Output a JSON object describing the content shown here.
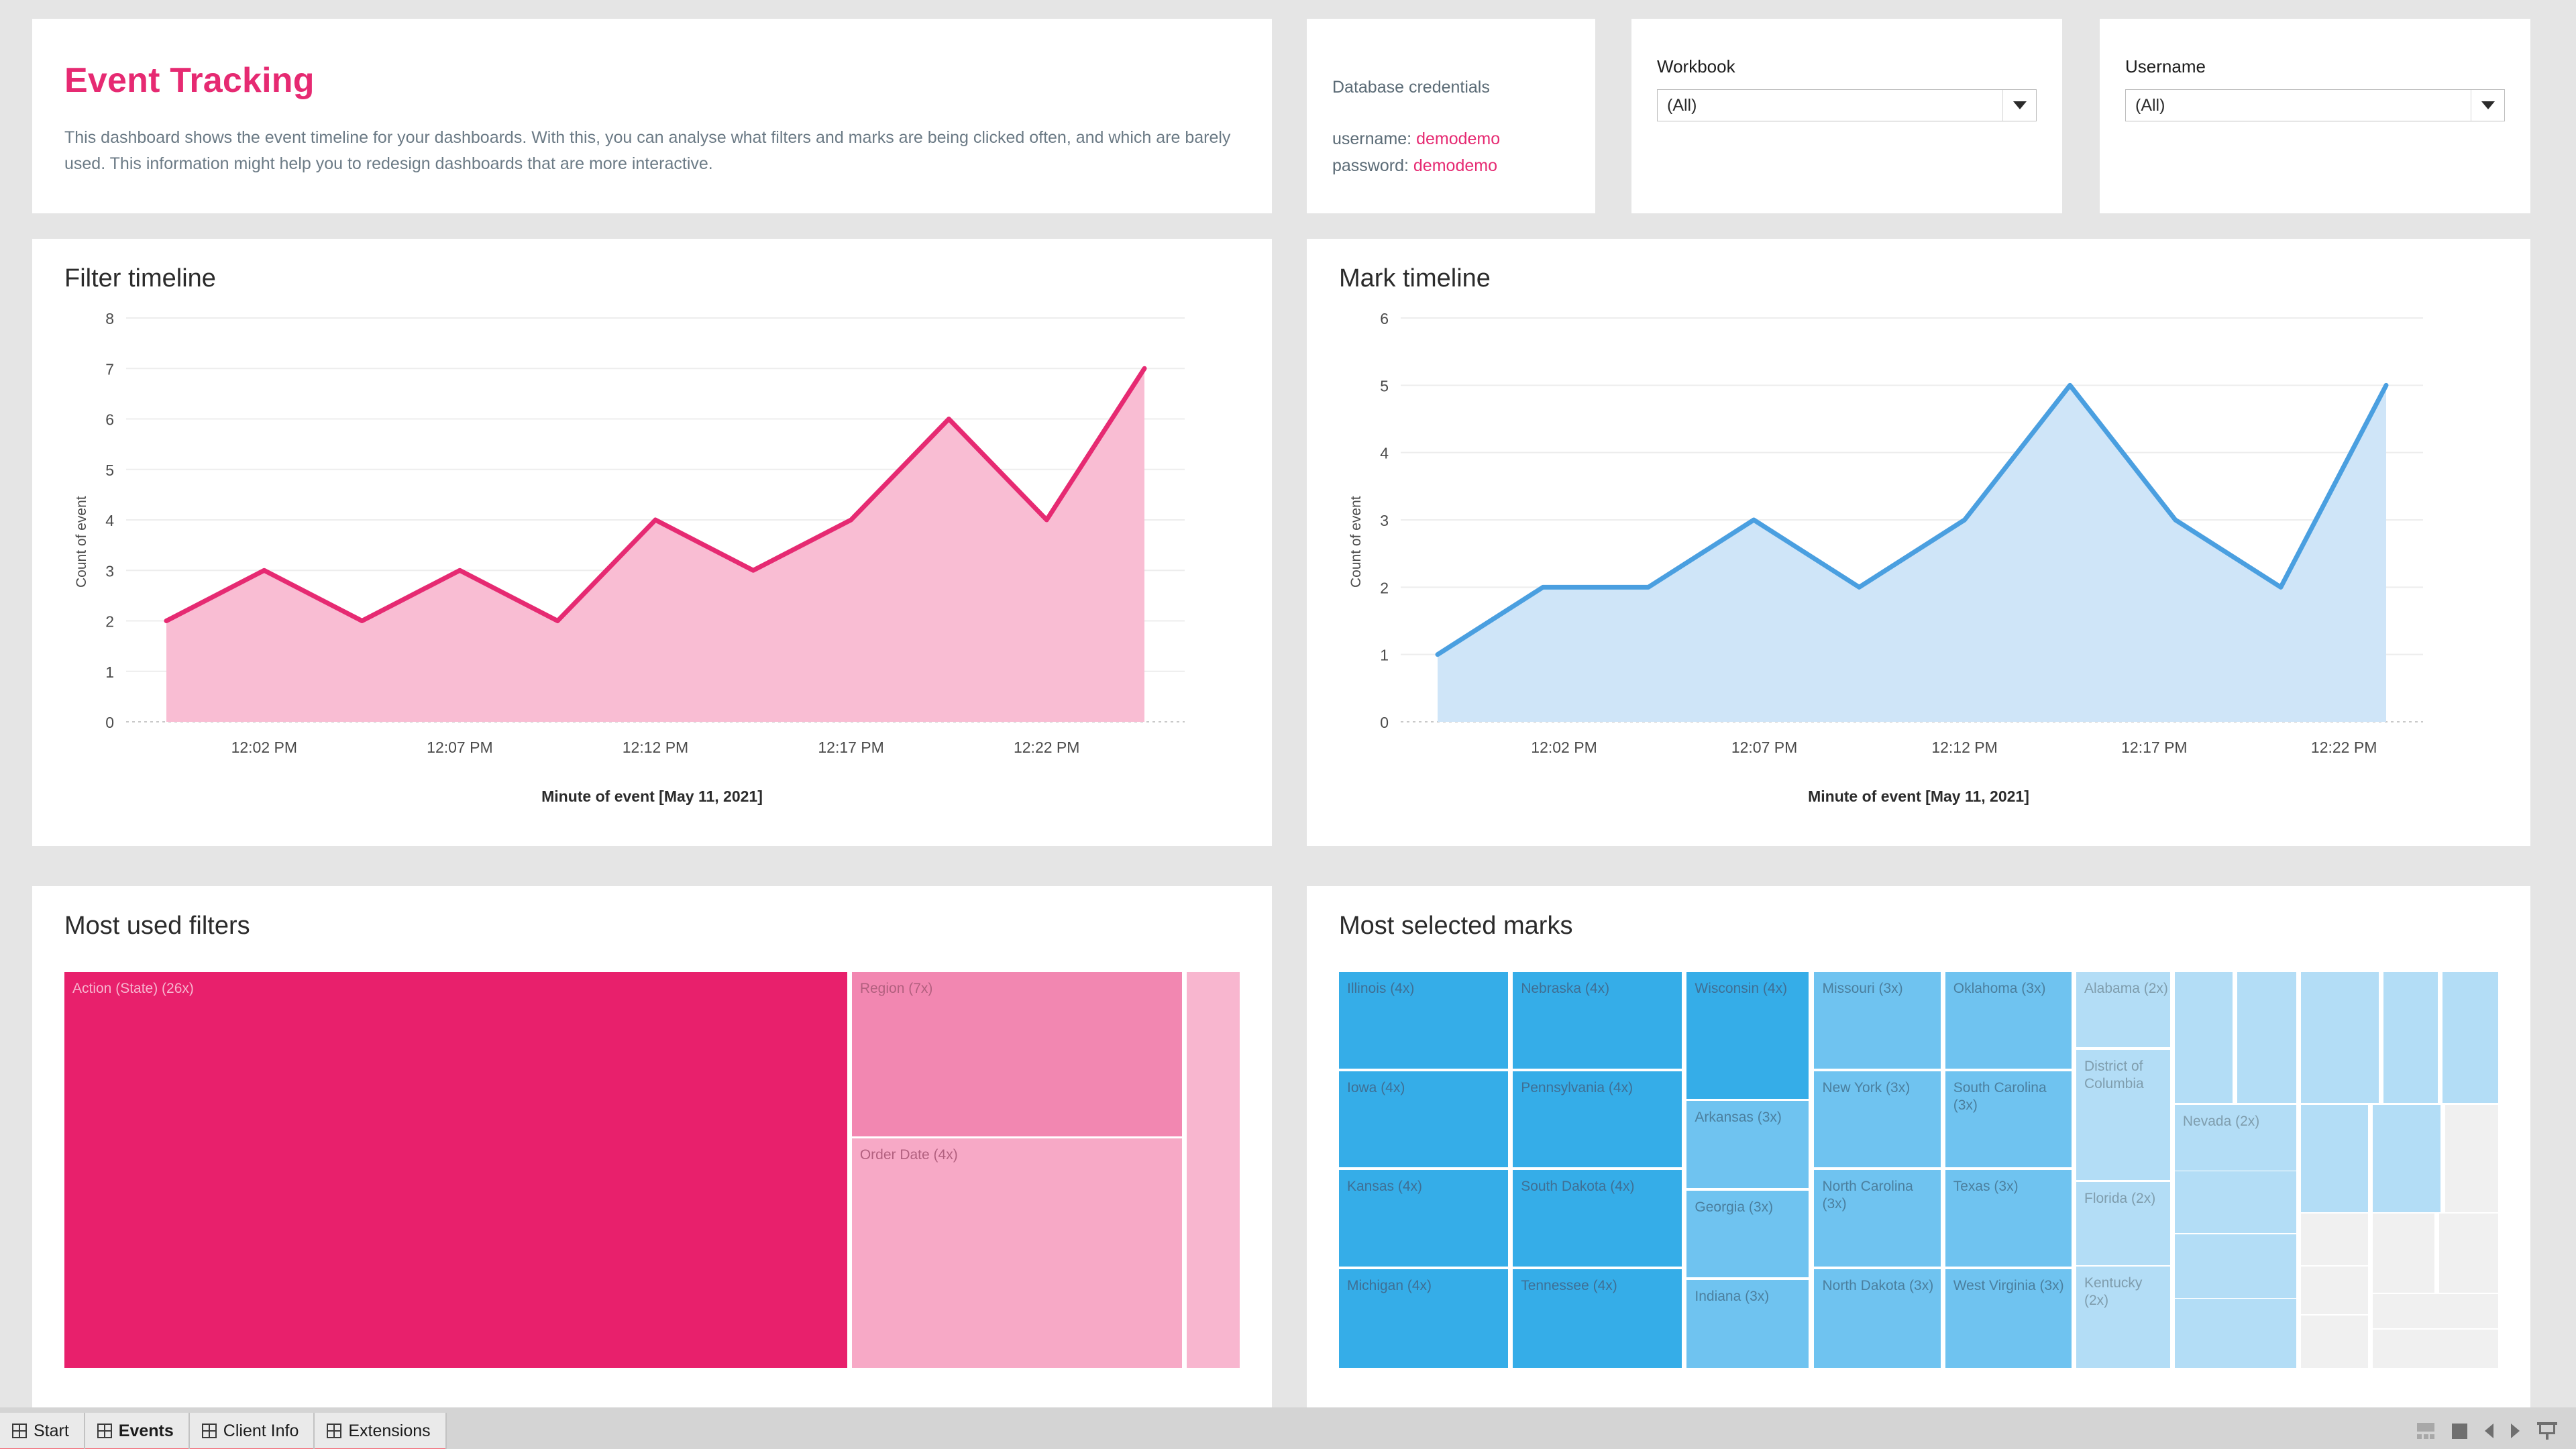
{
  "header": {
    "title": "Event Tracking",
    "description": "This dashboard shows the event timeline for your dashboards. With this, you can analyse what filters and marks are being clicked often, and which are barely used. This information might help you to redesign dashboards that are more interactive."
  },
  "credentials": {
    "heading": "Database credentials",
    "username_label": "username:",
    "username_value": "demodemo",
    "password_label": "password:",
    "password_value": "demodemo"
  },
  "filters": {
    "workbook": {
      "label": "Workbook",
      "value": "(All)",
      "icon": "chevron-down-icon"
    },
    "username": {
      "label": "Username",
      "value": "(All)",
      "icon": "chevron-down-icon"
    }
  },
  "panels": {
    "filter_timeline": "Filter timeline",
    "mark_timeline": "Mark timeline",
    "most_used_filters": "Most used filters",
    "most_selected_marks": "Most selected marks"
  },
  "colors": {
    "pink_accent": "#e62a72",
    "pink_line": "#e62a72",
    "pink_fill": "#f9bdd3",
    "pink_tile_dark": "#e8206c",
    "pink_tile_mid": "#f287b1",
    "pink_tile_light": "#f7a9c6",
    "pink_tile_lighter": "#f8b6cf",
    "blue_line": "#4a9fe0",
    "blue_fill": "#cfe5f8",
    "blue_tile_dark": "#35ade8",
    "blue_tile_mid": "#6fc3f0",
    "blue_tile_light": "#b3ddf6",
    "grey_tile": "#f0f0f0",
    "tab_underline": "#f4606f"
  },
  "chart_data": [
    {
      "type": "area",
      "title": "Filter timeline",
      "xlabel": "Minute of event [May 11, 2021]",
      "ylabel": "Count of event",
      "ylim": [
        0,
        8
      ],
      "yticks": [
        0,
        1,
        2,
        3,
        4,
        5,
        6,
        7,
        8
      ],
      "xticks": [
        "12:02 PM",
        "12:07 PM",
        "12:12 PM",
        "12:17 PM",
        "12:22 PM"
      ],
      "grid": true,
      "values": [
        2,
        3,
        2,
        3,
        2,
        4,
        3,
        4,
        6,
        4,
        7
      ],
      "line_color": "#e62a72",
      "fill_color": "#f9bdd3"
    },
    {
      "type": "area",
      "title": "Mark timeline",
      "xlabel": "Minute of event [May 11, 2021]",
      "ylabel": "Count of event",
      "ylim": [
        0,
        6
      ],
      "yticks": [
        0,
        1,
        2,
        3,
        4,
        5,
        6
      ],
      "xticks": [
        "12:02 PM",
        "12:07 PM",
        "12:12 PM",
        "12:17 PM",
        "12:22 PM"
      ],
      "grid": true,
      "values": [
        1,
        2,
        2,
        3,
        2,
        3,
        5,
        3,
        2,
        5
      ],
      "line_color": "#4a9fe0",
      "fill_color": "#cfe5f8"
    },
    {
      "type": "treemap",
      "title": "Most used filters",
      "items": [
        {
          "label": "Action (State) (26x)",
          "value": 26,
          "color": "#e8206c",
          "tone": "pink-dark"
        },
        {
          "label": "Region (7x)",
          "value": 7,
          "color": "#f287b1",
          "tone": "pink"
        },
        {
          "label": "Order Date (4x)",
          "value": 4,
          "color": "#f7a9c6",
          "tone": "pink"
        },
        {
          "label": "",
          "value": 4,
          "color": "#f8b6cf",
          "tone": "pink"
        }
      ]
    },
    {
      "type": "treemap",
      "title": "Most selected marks",
      "items": [
        {
          "label": "Illinois (4x)",
          "value": 4,
          "color": "#35ade8",
          "tone": "blue-dark"
        },
        {
          "label": "Iowa (4x)",
          "value": 4,
          "color": "#35ade8",
          "tone": "blue-dark"
        },
        {
          "label": "Kansas (4x)",
          "value": 4,
          "color": "#35ade8",
          "tone": "blue-dark"
        },
        {
          "label": "Michigan (4x)",
          "value": 4,
          "color": "#35ade8",
          "tone": "blue-dark"
        },
        {
          "label": "Nebraska (4x)",
          "value": 4,
          "color": "#35ade8",
          "tone": "blue-dark"
        },
        {
          "label": "Pennsylvania (4x)",
          "value": 4,
          "color": "#35ade8",
          "tone": "blue-dark"
        },
        {
          "label": "South Dakota (4x)",
          "value": 4,
          "color": "#35ade8",
          "tone": "blue-dark"
        },
        {
          "label": "Tennessee (4x)",
          "value": 4,
          "color": "#35ade8",
          "tone": "blue-dark"
        },
        {
          "label": "Wisconsin (4x)",
          "value": 4,
          "color": "#35ade8",
          "tone": "blue-dark"
        },
        {
          "label": "Arkansas (3x)",
          "value": 3,
          "color": "#6fc3f0",
          "tone": "blue"
        },
        {
          "label": "Georgia (3x)",
          "value": 3,
          "color": "#6fc3f0",
          "tone": "blue"
        },
        {
          "label": "Indiana (3x)",
          "value": 3,
          "color": "#6fc3f0",
          "tone": "blue"
        },
        {
          "label": "Missouri (3x)",
          "value": 3,
          "color": "#6fc3f0",
          "tone": "blue"
        },
        {
          "label": "New York (3x)",
          "value": 3,
          "color": "#6fc3f0",
          "tone": "blue"
        },
        {
          "label": "North Carolina (3x)",
          "value": 3,
          "color": "#6fc3f0",
          "tone": "blue"
        },
        {
          "label": "North Dakota (3x)",
          "value": 3,
          "color": "#6fc3f0",
          "tone": "blue"
        },
        {
          "label": "Oklahoma (3x)",
          "value": 3,
          "color": "#6fc3f0",
          "tone": "blue"
        },
        {
          "label": "South Carolina (3x)",
          "value": 3,
          "color": "#6fc3f0",
          "tone": "blue"
        },
        {
          "label": "Texas (3x)",
          "value": 3,
          "color": "#6fc3f0",
          "tone": "blue"
        },
        {
          "label": "West Virginia (3x)",
          "value": 3,
          "color": "#6fc3f0",
          "tone": "blue"
        },
        {
          "label": "Alabama (2x)",
          "value": 2,
          "color": "#b3ddf6",
          "tone": "blue-light"
        },
        {
          "label": "District of Columbia",
          "value": 2,
          "color": "#b3ddf6",
          "tone": "blue-light"
        },
        {
          "label": "Florida (2x)",
          "value": 2,
          "color": "#b3ddf6",
          "tone": "blue-light"
        },
        {
          "label": "Kentucky (2x)",
          "value": 2,
          "color": "#b3ddf6",
          "tone": "blue-light"
        },
        {
          "label": "Nevada (2x)",
          "value": 2,
          "color": "#b3ddf6",
          "tone": "blue-light"
        }
      ]
    }
  ],
  "tabbar": {
    "tabs": [
      {
        "label": "Start",
        "active": false,
        "icon": "grid-icon"
      },
      {
        "label": "Events",
        "active": true,
        "icon": "grid-icon"
      },
      {
        "label": "Client Info",
        "active": false,
        "icon": "grid-icon"
      },
      {
        "label": "Extensions",
        "active": false,
        "icon": "grid-icon"
      }
    ],
    "tools": [
      {
        "name": "layout-icon"
      },
      {
        "name": "fit-square-icon"
      },
      {
        "name": "arrow-left-icon"
      },
      {
        "name": "arrow-right-icon"
      },
      {
        "name": "presentation-icon"
      }
    ]
  }
}
